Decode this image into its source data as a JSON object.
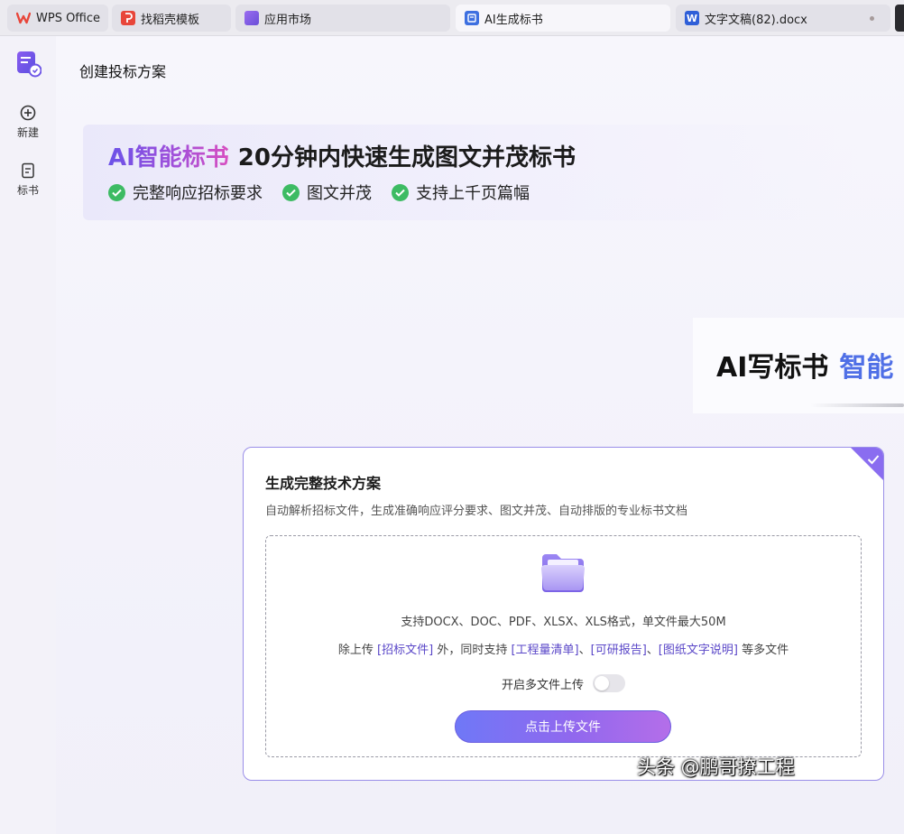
{
  "tabs": [
    {
      "label": "WPS Office",
      "icon": "wps-logo-icon",
      "color": "#e8463a"
    },
    {
      "label": "找稻壳模板",
      "icon": "docer-icon",
      "color": "#e8463a"
    },
    {
      "label": "应用市场",
      "icon": "app-market-icon",
      "color": "#7a4fe0"
    },
    {
      "label": "AI生成标书",
      "icon": "ai-bid-icon",
      "color": "#3d6fe0"
    },
    {
      "label": "文字文稿(82).docx",
      "icon": "word-doc-icon",
      "icon_text": "W",
      "color": "#2f5fd8"
    }
  ],
  "rail": {
    "items": [
      {
        "label": "新建",
        "icon": "plus-circle-icon"
      },
      {
        "label": "标书",
        "icon": "document-icon"
      }
    ]
  },
  "page": {
    "title": "创建投标方案"
  },
  "hero": {
    "brand": "AI智能标书",
    "headline": "20分钟内快速生成图文并茂标书",
    "features": [
      "完整响应招标要求",
      "图文并茂",
      "支持上千页篇幅"
    ]
  },
  "promo": {
    "text_a": "AI写标书",
    "text_b": "智能"
  },
  "card": {
    "title": "生成完整技术方案",
    "description": "自动解析招标文件，生成准确响应评分要求、图文并茂、自动排版的专业标书文档",
    "formats": "支持DOCX、DOC、PDF、XLSX、XLS格式，单文件最大50M",
    "extra": {
      "prefix": "除上传 ",
      "item1": "[招标文件]",
      "middle": " 外，同时支持 ",
      "item2": "[工程量清单]",
      "sep1": "、",
      "item3": "[可研报告]",
      "sep2": "、",
      "item4": "[图纸文字说明]",
      "suffix": " 等多文件"
    },
    "multi_upload_label": "开启多文件上传",
    "multi_upload_enabled": false,
    "upload_button": "点击上传文件"
  },
  "watermark": "头条 @鹏哥撩工程",
  "colors": {
    "accent": "#8a6df0",
    "check_green": "#3dbb63",
    "link_purple": "#5a47c8"
  }
}
